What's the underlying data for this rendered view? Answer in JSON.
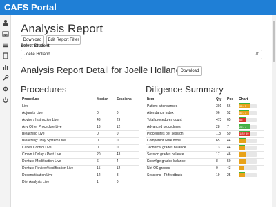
{
  "app": {
    "title": "CAFS Portal"
  },
  "sidebar": {
    "icons": [
      "user-icon",
      "inbox-icon",
      "list-icon",
      "file-icon",
      "chart-icon",
      "wrench-icon",
      "gear-icon",
      "power-icon"
    ]
  },
  "report": {
    "title": "Analysis Report",
    "download_label": "Download",
    "edit_filter_label": "Edit Report Filter",
    "select_label": "Select Student",
    "selected_student": "Joelle Holland",
    "detail_title": "Analysis Report Detail for Joelle Holland:",
    "detail_download_label": "Download"
  },
  "procedures": {
    "title": "Procedures",
    "headers": [
      "Procedure",
      "Median",
      "Sessions"
    ],
    "rows": [
      [
        "Live",
        "",
        ""
      ],
      [
        "Adjuncts Live",
        "0",
        "0"
      ],
      [
        "Advice / Instruction Live",
        "43",
        "29"
      ],
      [
        "Any Other Procedure Live",
        "13",
        "12"
      ],
      [
        "Bleaching Live",
        "0",
        "0"
      ],
      [
        "Bleaching: Tray System Live",
        "0",
        "0"
      ],
      [
        "Caries Control Live",
        "0",
        "0"
      ],
      [
        "Crown / Onlay / Post Live",
        "20",
        "43"
      ],
      [
        "Denture Modification Live",
        "6",
        "4"
      ],
      [
        "Denture Review/Modification Live",
        "15",
        "12"
      ],
      [
        "Desensitisation Live",
        "12",
        "8"
      ],
      [
        "Diet Analysis Live",
        "1",
        "0"
      ]
    ]
  },
  "diligence": {
    "title": "Diligence Summary",
    "headers": [
      "Item",
      "Qty",
      "Pos",
      "Chart"
    ],
    "rows": [
      {
        "item": "Patient attendances",
        "qty": "301",
        "pos": "56",
        "bar_label": "56 / 3",
        "fill": 0.62,
        "color": "#e8a21a"
      },
      {
        "item": "Attendance index",
        "qty": "96",
        "pos": "52",
        "bar_label": "52 / 3",
        "fill": 0.58,
        "color": "#e8a21a"
      },
      {
        "item": "Total procedures count",
        "qty": "473",
        "pos": "65",
        "bar_label": "65",
        "fill": 0.38,
        "color": "#d9342b"
      },
      {
        "item": "Advanced procedures",
        "qty": "28",
        "pos": "7",
        "bar_label": "26 / 7",
        "fill": 0.66,
        "color": "#4cae4c"
      },
      {
        "item": "Procedures per session",
        "qty": "1.8",
        "pos": "59",
        "bar_label": "1.8 / 59",
        "fill": 0.62,
        "color": "#d9342b"
      },
      {
        "item": "Competent work done",
        "qty": "65",
        "pos": "44",
        "bar_label": "",
        "fill": 0.44,
        "color": "#e8a21a"
      },
      {
        "item": "Technical grades balance",
        "qty": "13",
        "pos": "44",
        "bar_label": "",
        "fill": 0.36,
        "color": "#e8a21a"
      },
      {
        "item": "Session grades balance",
        "qty": "17",
        "pos": "46",
        "bar_label": "",
        "fill": 0.38,
        "color": "#e8a21a"
      },
      {
        "item": "Knowl'ge grades balance",
        "qty": "8",
        "pos": "50",
        "bar_label": "",
        "fill": 0.4,
        "color": "#e8a21a"
      },
      {
        "item": "Not OK grades",
        "qty": "0",
        "pos": "43",
        "bar_label": "",
        "fill": 0.3,
        "color": "#e8a21a"
      },
      {
        "item": "Sessions - Pt feedback",
        "qty": "19",
        "pos": "25",
        "bar_label": "",
        "fill": 0.34,
        "color": "#e8a21a"
      }
    ]
  }
}
